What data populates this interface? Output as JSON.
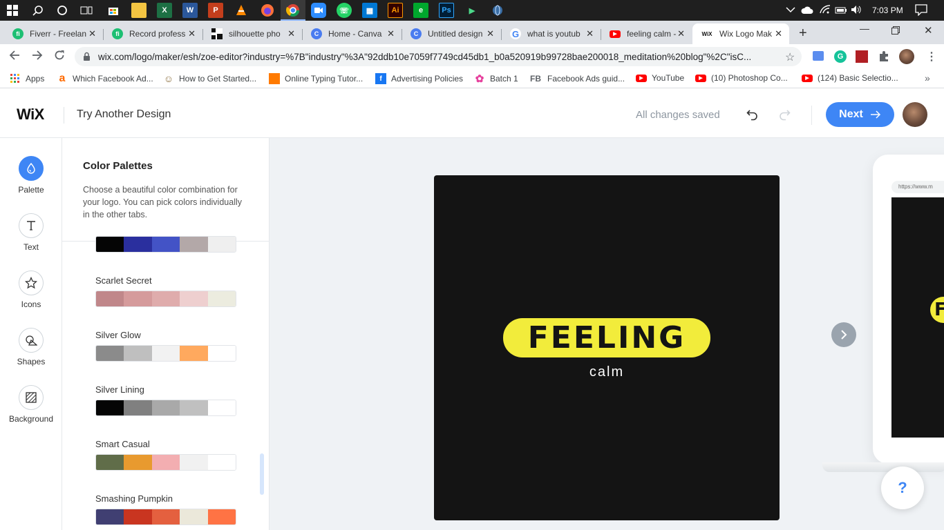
{
  "taskbar": {
    "icons": [
      "start-icon",
      "search-icon",
      "cortana-icon",
      "task-view-icon",
      "store-icon",
      "file-explorer-icon",
      "excel-icon",
      "word-icon",
      "powerpoint-icon",
      "vlc-icon",
      "firefox-icon",
      "chrome-icon",
      "zoom-icon",
      "whatsapp-icon",
      "calendar-icon",
      "illustrator-icon",
      "evernote-icon",
      "photoshop-icon",
      "media-icon",
      "globe-icon"
    ],
    "clock": "7:03 PM"
  },
  "tabs": [
    {
      "label": "Fiverr - Freelan",
      "favicon": "fiverr-icon",
      "color": "#1dbf73",
      "glyph": "fi"
    },
    {
      "label": "Record profess",
      "favicon": "fiverr-icon",
      "color": "#1dbf73",
      "glyph": "fi"
    },
    {
      "label": "silhouette pho",
      "favicon": "silhouette-icon",
      "color": "#111111",
      "glyph": ""
    },
    {
      "label": "Home - Canva",
      "favicon": "canva-icon",
      "color": "#4a7cf0",
      "glyph": "C"
    },
    {
      "label": "Untitled design",
      "favicon": "canva-icon",
      "color": "#4a7cf0",
      "glyph": "C"
    },
    {
      "label": "what is youtub",
      "favicon": "google-icon",
      "color": "#ffffff",
      "glyph": "G"
    },
    {
      "label": "feeling calm -",
      "favicon": "youtube-icon",
      "color": "#ff0000",
      "glyph": "▶"
    },
    {
      "label": "Wix Logo Mak",
      "favicon": "wix-icon",
      "color": "#ffffff",
      "glyph": "WiX"
    }
  ],
  "address": {
    "url": "wix.com/logo/maker/esh/zoe-editor?industry=%7B\"industry\"%3A\"92ddb10e7059f7749cd45db1_b0a520919b99728bae200018_meditation%20blog\"%2C\"isC..."
  },
  "bookmarks": [
    {
      "label": "Apps",
      "icon": "apps-grid-icon",
      "color": "#ea4335",
      "glyph": "⋮⋮"
    },
    {
      "label": "Which Facebook Ad...",
      "icon": "amazon-icon",
      "color": "#ff6a00",
      "glyph": "a"
    },
    {
      "label": "How to Get Started...",
      "icon": "person-icon",
      "color": "#8a6d3b",
      "glyph": "☺"
    },
    {
      "label": "Online Typing Tutor...",
      "icon": "typing-icon",
      "color": "#ff7a00",
      "glyph": ""
    },
    {
      "label": "Advertising Policies",
      "icon": "facebook-icon",
      "color": "#1877f2",
      "glyph": "f"
    },
    {
      "label": "Batch 1",
      "icon": "pinwheel-icon",
      "color": "#e6409d",
      "glyph": "✿"
    },
    {
      "label": "Facebook Ads guid...",
      "icon": "fb-text-icon",
      "color": "#ffffff",
      "glyph": "FB"
    },
    {
      "label": "YouTube",
      "icon": "youtube-icon",
      "color": "#ff0000",
      "glyph": "▶"
    },
    {
      "label": "(10) Photoshop Co...",
      "icon": "youtube-icon",
      "color": "#ff0000",
      "glyph": "▶"
    },
    {
      "label": "(124) Basic Selectio...",
      "icon": "youtube-icon",
      "color": "#ff0000",
      "glyph": "▶"
    }
  ],
  "wix": {
    "logo": "WiX",
    "try_another": "Try Another Design",
    "saved_status": "All changes saved",
    "next_label": "Next"
  },
  "rail": {
    "items": [
      {
        "label": "Palette",
        "icon": "palette-drop-icon",
        "active": true
      },
      {
        "label": "Text",
        "icon": "text-t-icon",
        "active": false
      },
      {
        "label": "Icons",
        "icon": "star-icon",
        "active": false
      },
      {
        "label": "Shapes",
        "icon": "shapes-icon",
        "active": false
      },
      {
        "label": "Background",
        "icon": "background-hatch-icon",
        "active": false
      }
    ]
  },
  "panel": {
    "title": "Color Palettes",
    "description": "Choose a beautiful color combination for your logo. You can pick colors individually in the other tabs.",
    "partial_palette": [
      "#050505",
      "#2a2f9e",
      "#4353c6",
      "#b3a8a8",
      "#efefef"
    ],
    "palettes": [
      {
        "name": "Scarlet Secret",
        "colors": [
          "#c0878a",
          "#d59b9c",
          "#dfacac",
          "#eecfcf",
          "#ececdf"
        ]
      },
      {
        "name": "Silver Glow",
        "colors": [
          "#8b8b8b",
          "#bfbfbf",
          "#f2f2f2",
          "#ffa95e",
          "#ffffff"
        ]
      },
      {
        "name": "Silver Lining",
        "colors": [
          "#050505",
          "#808080",
          "#a9a9a9",
          "#c0c0c0",
          "#ffffff"
        ]
      },
      {
        "name": "Smart Casual",
        "colors": [
          "#606d49",
          "#e89a2f",
          "#f3aeb1",
          "#f1f1f1",
          "#ffffff"
        ]
      },
      {
        "name": "Smashing Pumpkin",
        "colors": [
          "#403f72",
          "#c93520",
          "#e4603f",
          "#ebe8da",
          "#ff7344"
        ]
      }
    ]
  },
  "canvas": {
    "logo_title": "FEELING",
    "logo_subtitle": "calm",
    "mockup_url": "https://www.m",
    "mockup_pill_text": "F",
    "help_label": "?"
  }
}
